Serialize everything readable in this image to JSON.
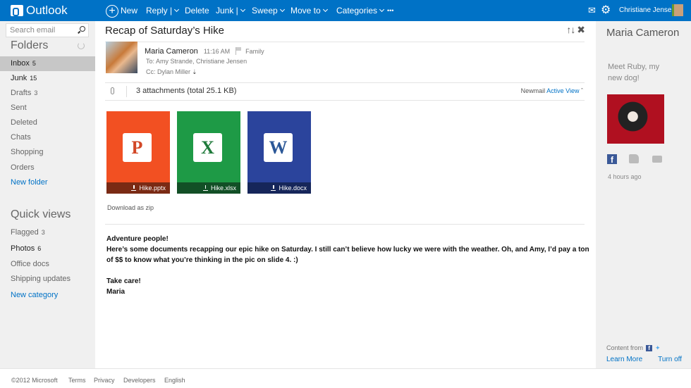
{
  "app": {
    "title": "Outlook"
  },
  "toolbar": {
    "new": "New",
    "reply": "Reply |",
    "delete": "Delete",
    "junk": "Junk |",
    "sweep": "Sweep",
    "move_to": "Move to",
    "categories": "Categories",
    "more": "•••"
  },
  "user": {
    "name": "Christiane Jensen"
  },
  "sidebar": {
    "search_placeholder": "Search email",
    "folders_title": "Folders",
    "folders": [
      {
        "label": "Inbox",
        "count": "5"
      },
      {
        "label": "Junk",
        "count": "15"
      },
      {
        "label": "Drafts",
        "count": "3"
      },
      {
        "label": "Sent",
        "count": ""
      },
      {
        "label": "Deleted",
        "count": ""
      },
      {
        "label": "Chats",
        "count": ""
      },
      {
        "label": "Shopping",
        "count": ""
      },
      {
        "label": "Orders",
        "count": ""
      }
    ],
    "new_folder": "New folder",
    "quick_views_title": "Quick views",
    "quick_views": [
      {
        "label": "Flagged",
        "count": "3"
      },
      {
        "label": "Photos",
        "count": "6"
      },
      {
        "label": "Office docs",
        "count": ""
      },
      {
        "label": "Shipping updates",
        "count": ""
      }
    ],
    "new_category": "New category"
  },
  "message": {
    "subject": "Recap of Saturday’s Hike",
    "sender": "Maria Cameron",
    "time": "11:16 AM",
    "category": "Family",
    "to": "To: Amy Strande, Christiane Jensen",
    "cc": "Cc: Dylan Miller",
    "attachments_summary": "3 attachments (total 25.1 KB)",
    "newmail": "Newmail",
    "active_view": "Active View",
    "attachments": [
      {
        "name": "Hike.pptx",
        "letter": "P",
        "color": "#f25022",
        "bar": "#7a2a14"
      },
      {
        "name": "Hike.xlsx",
        "letter": "X",
        "color": "#1e9a46",
        "bar": "#124f26"
      },
      {
        "name": "Hike.docx",
        "letter": "W",
        "color": "#2b449c",
        "bar": "#16265a"
      }
    ],
    "download_zip": "Download as zip",
    "body": [
      "Adventure people!",
      "Here’s some documents recapping our epic hike on Saturday. I still can’t believe how lucky we were with the weather. Oh, and Amy, I’d pay a ton of $$ to know what you’re thinking in the pic on slide 4.  :)",
      "",
      "Take care!",
      "Maria"
    ]
  },
  "social": {
    "name": "Maria Cameron",
    "status": "Meet Ruby, my new dog!",
    "ago": "4 hours ago",
    "content_from": "Content from",
    "learn_more": "Learn More",
    "turn_off": "Turn off"
  },
  "footer": {
    "copyright": "©2012 Microsoft",
    "terms": "Terms",
    "privacy": "Privacy",
    "developers": "Developers",
    "language": "English"
  }
}
